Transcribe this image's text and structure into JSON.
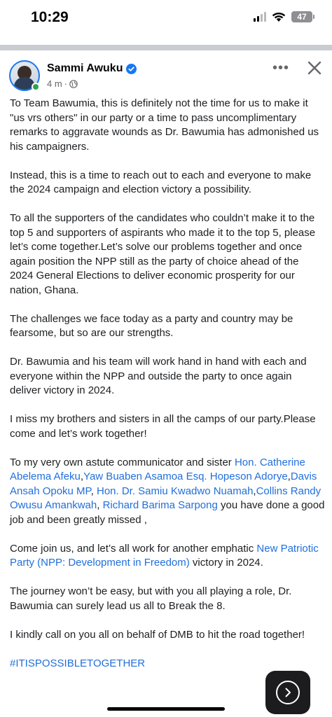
{
  "status_bar": {
    "time": "10:29",
    "battery": "47",
    "icons": [
      "signal-icon",
      "wifi-icon",
      "battery-icon"
    ]
  },
  "post": {
    "author": "Sammi Awuku",
    "time_ago": "4 m",
    "separator": "·",
    "icons": [
      "verified-icon",
      "globe-icon",
      "more-icon",
      "close-icon"
    ],
    "body": {
      "p1": "To Team Bawumia, this is definitely not the time for us to make it \"us vrs others\" in our party or a time to pass uncomplimentary remarks to aggravate wounds as Dr. Bawumia has admonished us his campaigners.",
      "p2": "Instead, this is a time to reach  out to each and everyone to make the 2024 campaign and election victory a possibility.",
      "p3": "To all the supporters of the candidates who couldn’t make it to the top 5 and supporters of aspirants who made it to the top 5, please let’s come together.Let’s solve our problems together and once again position the NPP still as the party of choice ahead of the 2024 General Elections to deliver economic prosperity for our  nation, Ghana.",
      "p4": "The challenges we face today as a party and country may be fearsome, but so are our strengths.",
      "p5": "Dr. Bawumia and his team will work hand in hand with each and  everyone within the NPP and outside the party to once again deliver victory in 2024.",
      "p6": "I miss my brothers and sisters in all the camps of our party.Please come and let’s work together!",
      "p7_prefix": "To my very own astute communicator and sister ",
      "p7_links": [
        "Hon. Catherine Abelema Afeku",
        "Yaw Buaben Asamoa Esq.",
        "Hopeson Adorye",
        "Davis Ansah Opoku MP",
        "Hon. Dr. Samiu Kwadwo Nuamah",
        "Collins Randy Owusu Amankwah",
        "Richard Barima Sarpong"
      ],
      "p7_comma": ",",
      "p7_comma_space": ", ",
      "p7_suffix": " you have done a good job and been greatly missed ,",
      "p8_prefix": "Come  join us, and let’s all work for another emphatic ",
      "p8_link": "New Patriotic Party (NPP: Development in Freedom)",
      "p8_suffix": " victory in 2024.",
      "p9": "The journey won’t be easy, but with you all playing a role, Dr. Bawumia can surely lead us all to Break the 8.",
      "p10": "I kindly call on you all on behalf of DMB to hit the road together!",
      "hashtag": "#ITISPOSSIBLETOGETHER"
    }
  },
  "floating": {
    "icon": "chevron-right-icon"
  },
  "colors": {
    "link": "#216fdb",
    "verified": "#1877f2",
    "online": "#31a24c"
  }
}
